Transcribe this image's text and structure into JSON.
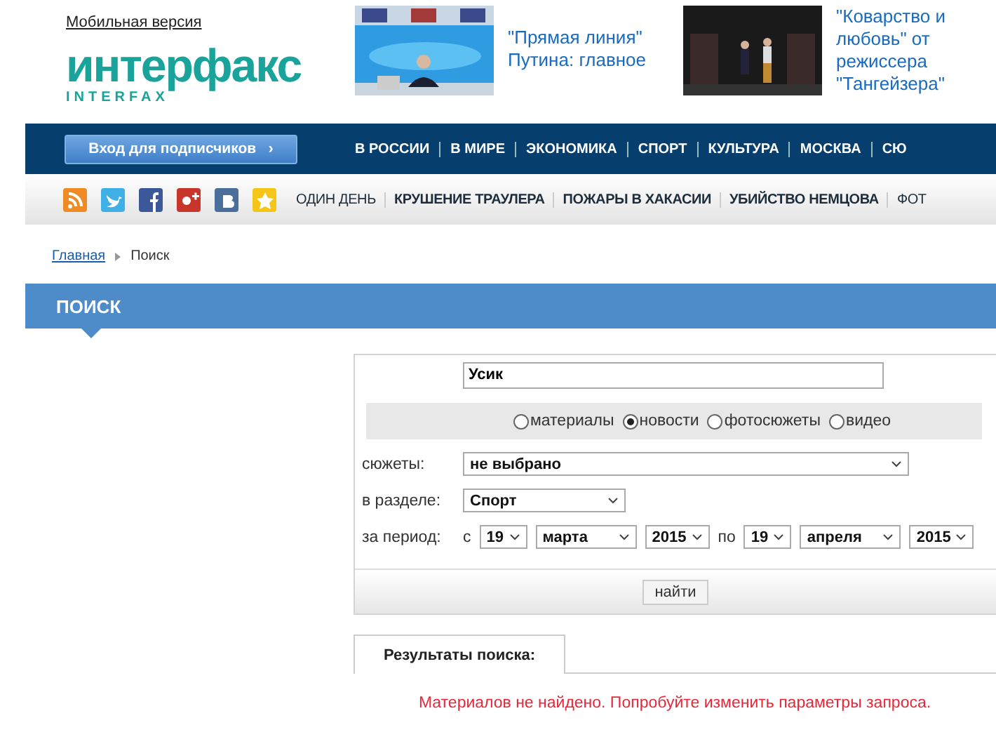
{
  "header": {
    "mobile_link": "Мобильная версия",
    "logo": {
      "word": "интерфакс",
      "latin": "INTERFAX"
    },
    "promos": [
      {
        "kind": "picture",
        "text": "\"Прямая линия\" Путина: главное"
      },
      {
        "kind": "picture",
        "text": "\"Коварство и любовь\" от режиссера \"Тангейзера\""
      }
    ]
  },
  "main_nav": {
    "login_button": "Вход для подписчиков",
    "arrow": "›",
    "items": [
      "В РОССИИ",
      "В МИРЕ",
      "ЭКОНОМИКА",
      "СПОРТ",
      "КУЛЬТУРА",
      "МОСКВА",
      "СЮ"
    ]
  },
  "sub_nav": {
    "social": [
      {
        "kind": "rss",
        "color": "#f08a24"
      },
      {
        "kind": "twitter",
        "color": "#3fb0e6"
      },
      {
        "kind": "facebook",
        "color": "#3b5998"
      },
      {
        "kind": "gplus",
        "color": "#c8362b"
      },
      {
        "kind": "vk",
        "color": "#4a6f9c"
      },
      {
        "kind": "star",
        "color": "#f5c518"
      }
    ],
    "items": [
      {
        "label": "ОДИН ДЕНЬ",
        "bold": false
      },
      {
        "label": "КРУШЕНИЕ ТРАУЛЕРА",
        "bold": true
      },
      {
        "label": "ПОЖАРЫ В ХАКАСИИ",
        "bold": true
      },
      {
        "label": "УБИЙСТВО НЕМЦОВА",
        "bold": true
      },
      {
        "label": "ФОТ",
        "bold": false
      }
    ]
  },
  "breadcrumb": [
    {
      "label": "Главная",
      "link": true
    },
    {
      "label": "Поиск",
      "link": false
    }
  ],
  "section_title": "ПОИСК",
  "search_form": {
    "query": "Усик",
    "types": [
      {
        "label": "материалы",
        "selected": false
      },
      {
        "label": "новости",
        "selected": true
      },
      {
        "label": "фотосюжеты",
        "selected": false
      },
      {
        "label": "видео",
        "selected": false
      }
    ],
    "topics": {
      "label": "сюжеты:",
      "value": "не выбрано"
    },
    "section": {
      "label": "в разделе:",
      "value": "Спорт"
    },
    "period": {
      "label": "за период:",
      "from_word": "с",
      "to_word": "по",
      "from": [
        "19",
        "марта",
        "2015"
      ],
      "to": [
        "19",
        "апреля",
        "2015"
      ]
    },
    "submit": "найти"
  },
  "results": {
    "tab": "Результаты поиска:",
    "message": "Материалов не найдено. Попробуйте изменить параметры запроса."
  }
}
